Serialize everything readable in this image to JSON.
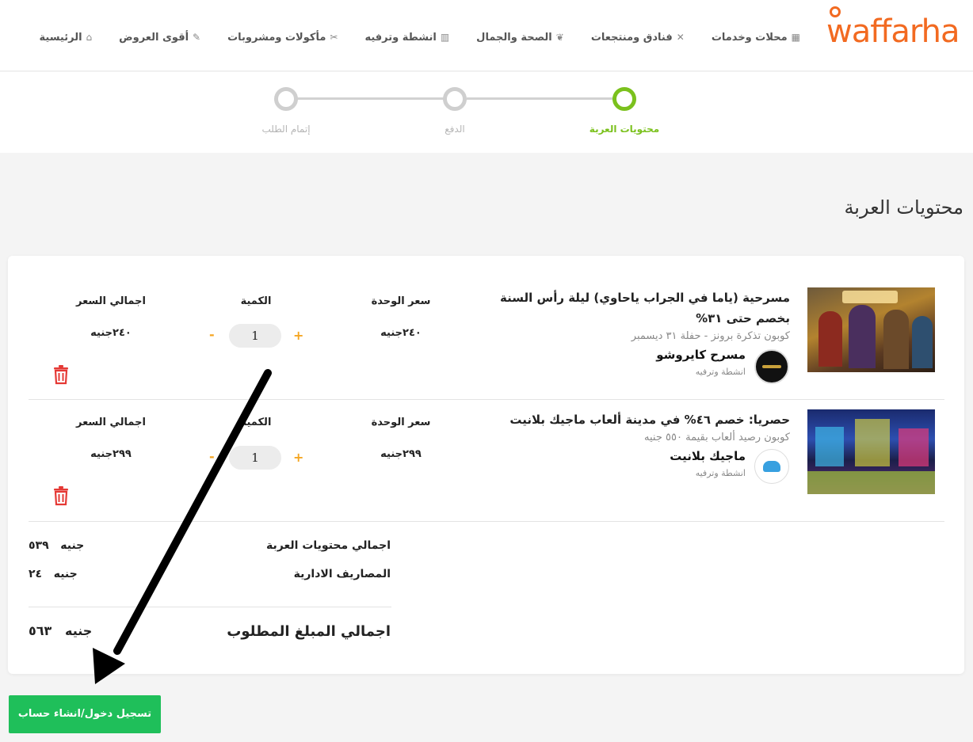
{
  "header": {
    "logo_text": "waffarha",
    "nav": [
      {
        "label": "الرئيسية",
        "icon": "store-icon",
        "glyph": "⌂"
      },
      {
        "label": "أقوى العروض",
        "icon": "tag-icon",
        "glyph": "✎"
      },
      {
        "label": "مأكولات ومشروبات",
        "icon": "utensils-icon",
        "glyph": "✂"
      },
      {
        "label": "انشطة وترفيه",
        "icon": "popcorn-icon",
        "glyph": "▥"
      },
      {
        "label": "الصحة والجمال",
        "icon": "leaf-icon",
        "glyph": "❦"
      },
      {
        "label": "فنادق ومنتجعات",
        "icon": "tools-icon",
        "glyph": "✕"
      },
      {
        "label": "محلات وخدمات",
        "icon": "shop-icon",
        "glyph": "▦"
      }
    ]
  },
  "steps": [
    {
      "label": "محتويات العربة",
      "active": true
    },
    {
      "label": "الدفع",
      "active": false
    },
    {
      "label": "إتمام الطلب",
      "active": false
    }
  ],
  "page_title": "محتويات العربة",
  "columns": {
    "unit_price": "سعر الوحدة",
    "quantity": "الكمية",
    "total_price": "اجمالي السعر"
  },
  "items": [
    {
      "title_line1": "مسرحية (ياما في الجراب ياحاوي) ليلة رأس السنة",
      "title_line2": "بخصم حتى ٣١%",
      "subtitle": "كوبون تذكرة برونز - حفلة ٣١ ديسمبر",
      "vendor": "مسرح كايروشو",
      "category": "انشطة وترفيه",
      "unit_price": "٢٤٠جنيه",
      "quantity": "1",
      "total_price": "٢٤٠جنيه"
    },
    {
      "title_line1": "حصريا: خصم ٤٦% في مدينة ألعاب ماجيك بلانيت",
      "subtitle": "كوبون رصيد ألعاب بقيمة ٥٥٠ جنيه",
      "vendor": "ماجيك بلانيت",
      "category": "انشطة وترفيه",
      "unit_price": "٢٩٩جنيه",
      "quantity": "1",
      "total_price": "٢٩٩جنيه"
    }
  ],
  "qty_plus": "+",
  "qty_minus": "-",
  "summary": {
    "subtotal_label": "اجمالي محتويات العربة",
    "subtotal_value": "٥٣٩",
    "fees_label": "المصاريف الادارية",
    "fees_value": "٢٤",
    "total_label": "اجمالي المبلغ المطلوب",
    "total_value": "٥٦٣",
    "currency": "جنيه"
  },
  "login_button": "تسجيل دخول/انشاء حساب",
  "colors": {
    "brand": "#f26a21",
    "step_active": "#7bc11d",
    "qty_accent": "#f5a623",
    "trash": "#e53935",
    "login_button": "#1fbf5a"
  }
}
